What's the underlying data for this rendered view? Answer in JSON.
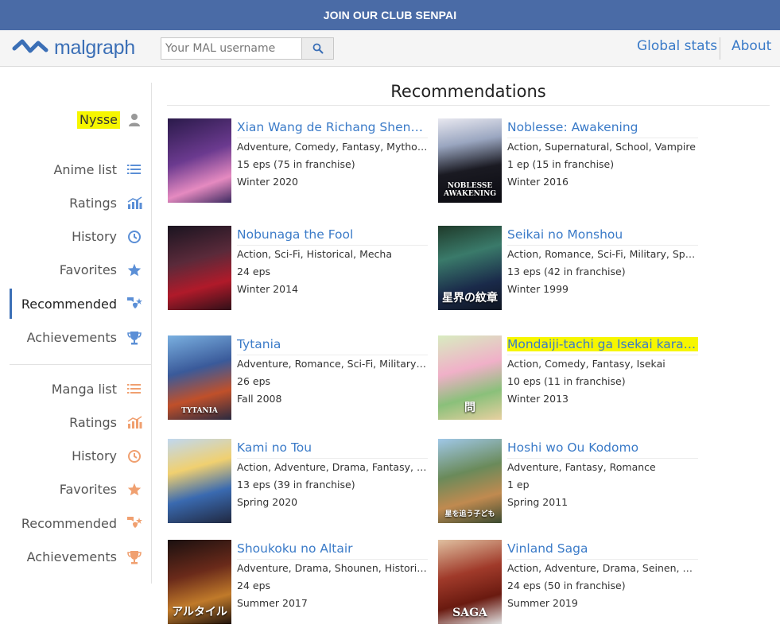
{
  "banner": {
    "text": "JOIN OUR CLUB SENPAI"
  },
  "header": {
    "logo_text": "malgraph",
    "search_placeholder": "Your MAL username",
    "nav": [
      {
        "label": "Global stats"
      },
      {
        "label": "About"
      }
    ]
  },
  "sidebar": {
    "username": "Nysse",
    "anime": [
      {
        "label": "Anime list",
        "icon": "list-icon"
      },
      {
        "label": "Ratings",
        "icon": "chart-icon"
      },
      {
        "label": "History",
        "icon": "history-icon"
      },
      {
        "label": "Favorites",
        "icon": "star-icon"
      },
      {
        "label": "Recommended",
        "icon": "recommend-icon",
        "active": true
      },
      {
        "label": "Achievements",
        "icon": "trophy-icon"
      }
    ],
    "manga": [
      {
        "label": "Manga list",
        "icon": "list-icon"
      },
      {
        "label": "Ratings",
        "icon": "chart-icon"
      },
      {
        "label": "History",
        "icon": "history-icon"
      },
      {
        "label": "Favorites",
        "icon": "star-icon"
      },
      {
        "label": "Recommended",
        "icon": "recommend-icon"
      },
      {
        "label": "Achievements",
        "icon": "trophy-icon"
      }
    ],
    "colors": {
      "anime_icon": "#5b8fd6",
      "manga_icon": "#f0a070"
    }
  },
  "main": {
    "title": "Recommendations",
    "cards": [
      {
        "title": "Xian Wang de Richang Shenghuo",
        "genres": "Adventure, Comedy, Fantasy, Mythology",
        "eps": "15 eps (75 in franchise)",
        "season": "Winter 2020"
      },
      {
        "title": "Noblesse: Awakening",
        "genres": "Action, Supernatural, School, Vampire",
        "eps": "1 ep (15 in franchise)",
        "season": "Winter 2016"
      },
      {
        "title": "Nobunaga the Fool",
        "genres": "Action, Sci-Fi, Historical, Mecha",
        "eps": "24 eps",
        "season": "Winter 2014"
      },
      {
        "title": "Seikai no Monshou",
        "genres": "Action, Romance, Sci-Fi, Military, Space",
        "eps": "13 eps (42 in franchise)",
        "season": "Winter 1999"
      },
      {
        "title": "Tytania",
        "genres": "Adventure, Romance, Sci-Fi, Military, Ps...",
        "eps": "26 eps",
        "season": "Fall 2008"
      },
      {
        "title": "Mondaiji-tachi ga Isekai kara Kuru Sou desu yo?",
        "genres": "Action, Comedy, Fantasy, Isekai",
        "eps": "10 eps (11 in franchise)",
        "season": "Winter 2013",
        "highlight": true
      },
      {
        "title": "Kami no Tou",
        "genres": "Action, Adventure, Drama, Fantasy, Mystery",
        "eps": "13 eps (39 in franchise)",
        "season": "Spring 2020"
      },
      {
        "title": "Hoshi wo Ou Kodomo",
        "genres": "Adventure, Fantasy, Romance",
        "eps": "1 ep",
        "season": "Spring 2011"
      },
      {
        "title": "Shoukoku no Altair",
        "genres": "Adventure, Drama, Shounen, Historical, ...",
        "eps": "24 eps",
        "season": "Summer 2017"
      },
      {
        "title": "Vinland Saga",
        "genres": "Action, Adventure, Drama, Seinen, Gore",
        "eps": "24 eps (50 in franchise)",
        "season": "Summer 2019"
      }
    ],
    "poster_text": [
      "",
      "NOBLESSE AWAKENING",
      "",
      "星界の紋章",
      "TYTANIA",
      "問",
      "",
      "星を追う子ども",
      "アルタイル",
      "SAGA"
    ],
    "highlight_color": "#f6f600",
    "link_color": "#3b7bc8"
  }
}
